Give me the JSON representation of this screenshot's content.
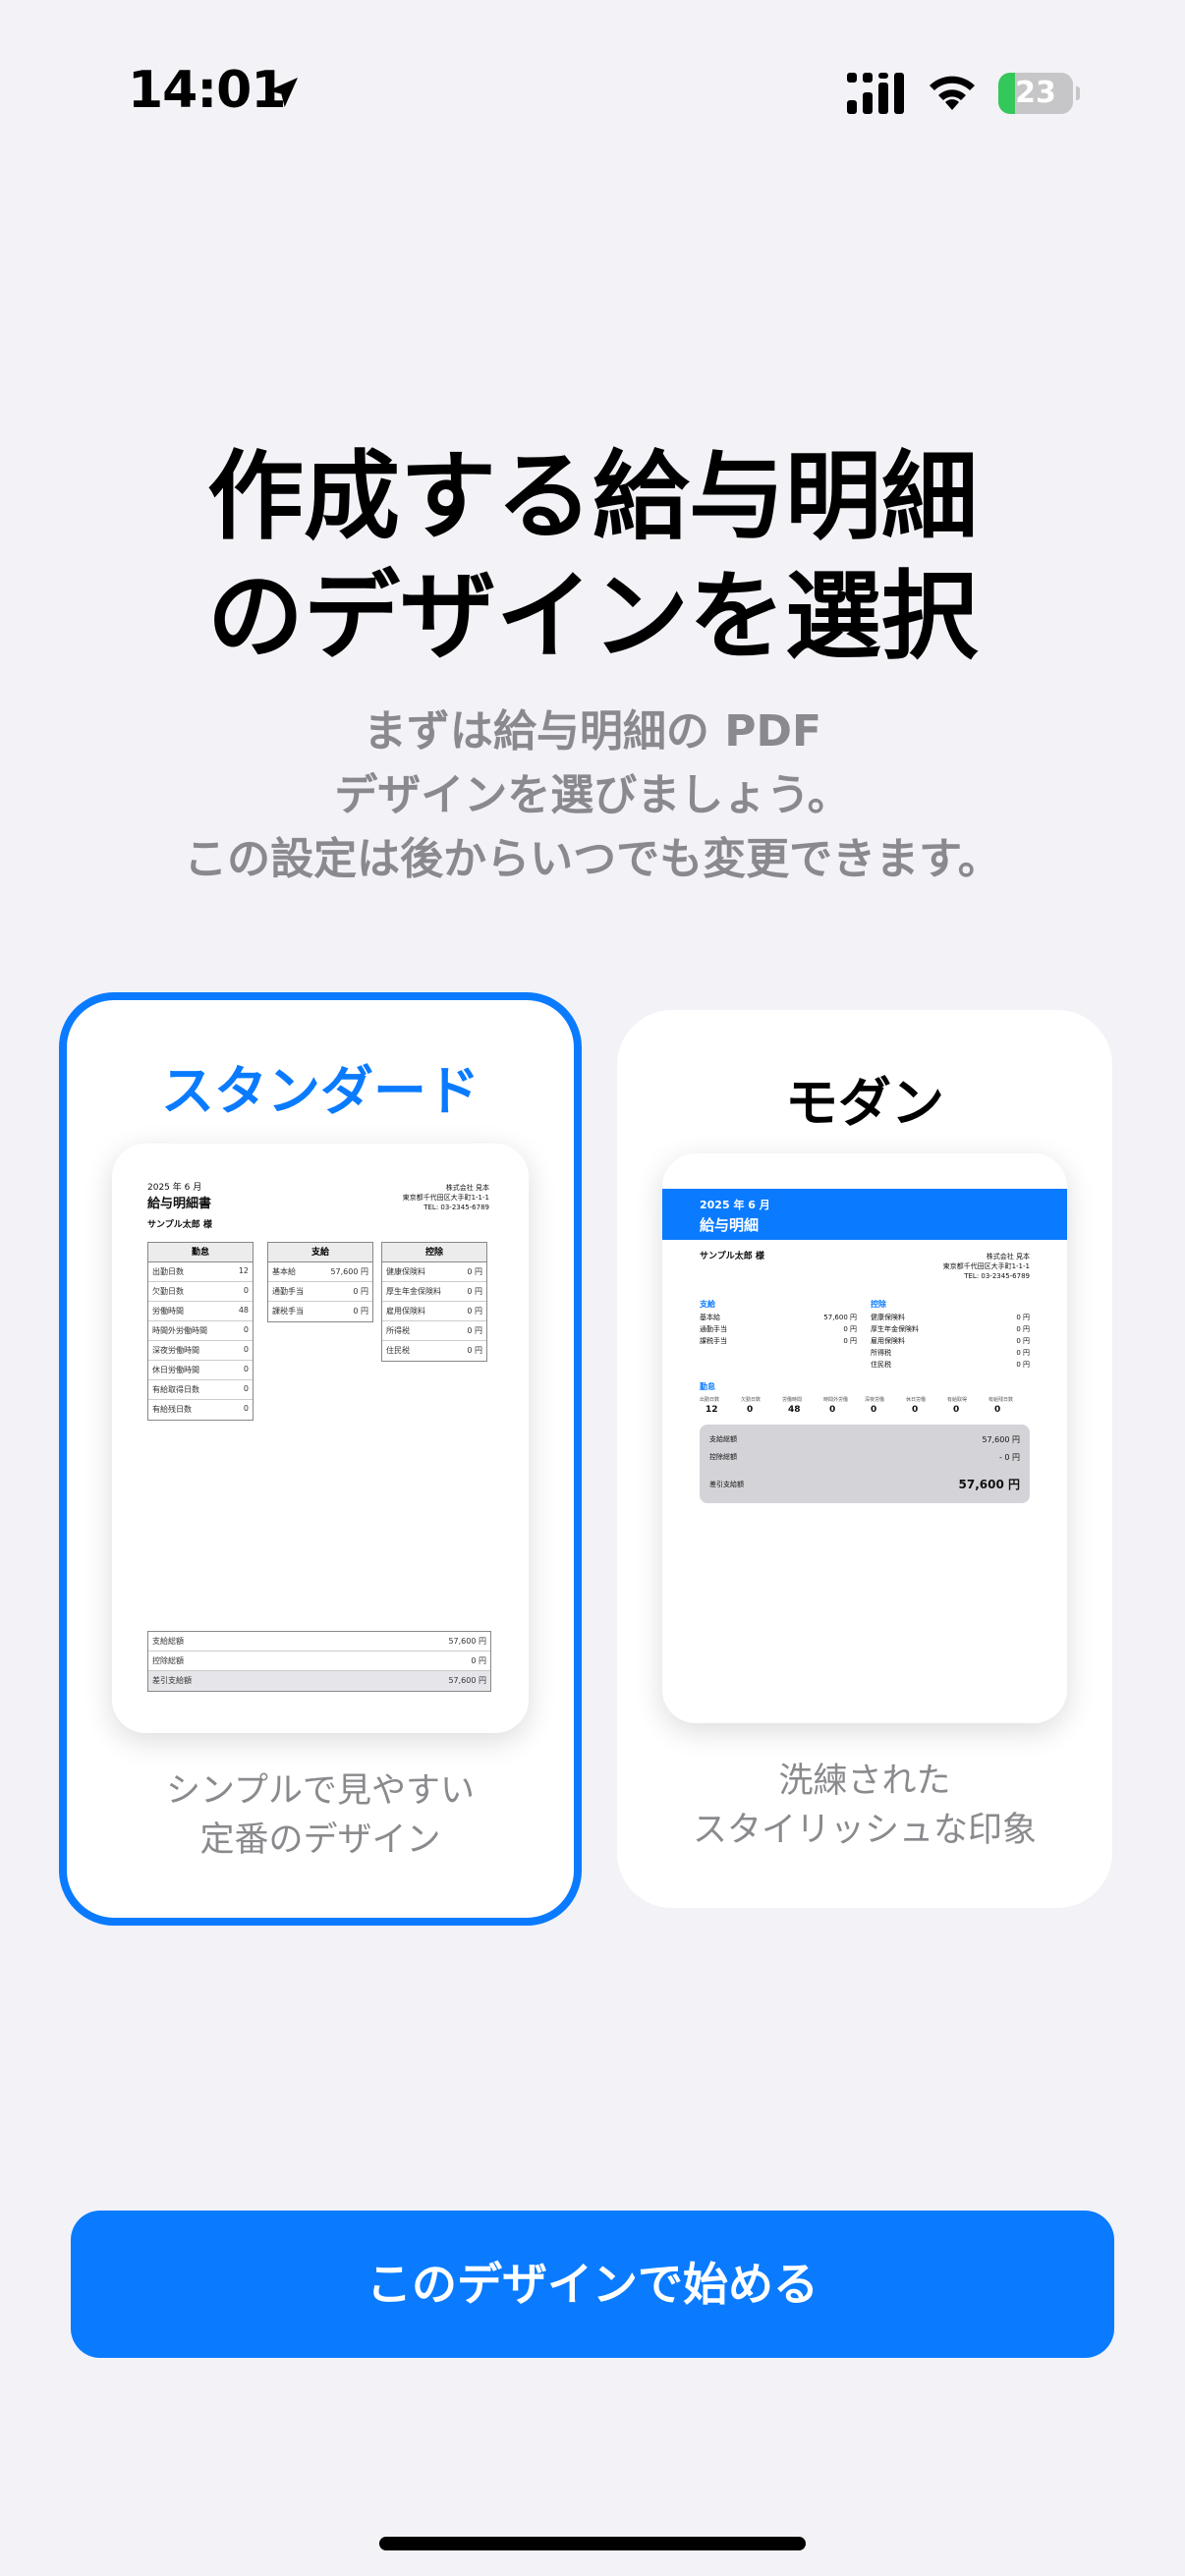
{
  "status_bar": {
    "time": "14:01",
    "battery_level": "23",
    "battery_fraction": 0.23,
    "battery_color": "#34c759"
  },
  "heading": {
    "title_line1": "作成する給与明細",
    "title_line2": "のデザインを選択",
    "subtitle_line1": "まずは給与明細の PDF",
    "subtitle_line2": "デザインを選びましょう。",
    "subtitle_line3": "この設定は後からいつでも変更できます。"
  },
  "options": [
    {
      "title": "スタンダード",
      "selected": true,
      "description_line1": "シンプルで見やすい",
      "description_line2": "定番のデザイン"
    },
    {
      "title": "モダン",
      "selected": false,
      "description_line1": "洗練された",
      "description_line2": "スタイリッシュな印象"
    }
  ],
  "preview_standard": {
    "period": "2025 年 6 月",
    "doc_title": "給与明細書",
    "employee": "サンプル太郎 様",
    "company": "株式会社 見本",
    "address": "東京都千代田区大手町1-1-1",
    "tel": "TEL: 03-2345-6789",
    "col_attendance": "勤怠",
    "col_payment": "支給",
    "col_deduction": "控除",
    "attendance_rows": [
      [
        "出勤日数",
        "12"
      ],
      [
        "欠勤日数",
        "0"
      ],
      [
        "労働時間",
        "48"
      ],
      [
        "時間外労働時間",
        "0"
      ],
      [
        "深夜労働時間",
        "0"
      ],
      [
        "休日労働時間",
        "0"
      ],
      [
        "有給取得日数",
        "0"
      ],
      [
        "有給残日数",
        "0"
      ]
    ],
    "payment_rows": [
      [
        "基本給",
        "57,600 円"
      ],
      [
        "通勤手当",
        "0 円"
      ],
      [
        "課税手当",
        "0 円"
      ]
    ],
    "deduction_rows": [
      [
        "健康保険料",
        "0 円"
      ],
      [
        "厚生年金保険料",
        "0 円"
      ],
      [
        "雇用保険料",
        "0 円"
      ],
      [
        "所得税",
        "0 円"
      ],
      [
        "住民税",
        "0 円"
      ]
    ],
    "total_rows": [
      [
        "支給総額",
        "57,600 円"
      ],
      [
        "控除総額",
        "0 円"
      ],
      [
        "差引支給額",
        "57,600 円"
      ]
    ]
  },
  "preview_modern": {
    "period": "2025 年 6 月",
    "doc_title": "給与明細",
    "employee": "サンプル太郎 様",
    "company": "株式会社 見本",
    "address": "東京都千代田区大手町1-1-1",
    "tel": "TEL: 03-2345-6789",
    "label_payment": "支給",
    "label_deduction": "控除",
    "label_attendance": "勤怠",
    "payment_rows": [
      [
        "基本給",
        "57,600 円"
      ],
      [
        "通勤手当",
        "0 円"
      ],
      [
        "課税手当",
        "0 円"
      ]
    ],
    "deduction_rows": [
      [
        "健康保険料",
        "0 円"
      ],
      [
        "厚生年金保険料",
        "0 円"
      ],
      [
        "雇用保険料",
        "0 円"
      ],
      [
        "所得税",
        "0 円"
      ],
      [
        "住民税",
        "0 円"
      ]
    ],
    "attendance_cells": [
      [
        "出勤日数",
        "12"
      ],
      [
        "欠勤日数",
        "0"
      ],
      [
        "労働時間",
        "48"
      ],
      [
        "時間外労働",
        "0"
      ],
      [
        "深夜労働",
        "0"
      ],
      [
        "休日労働",
        "0"
      ],
      [
        "有給取得",
        "0"
      ],
      [
        "有給残日数",
        "0"
      ]
    ],
    "total_pay_label": "支給総額",
    "total_pay": "57,600 円",
    "total_deduct_label": "控除総額",
    "total_deduct": "- 0 円",
    "net_label": "差引支給額",
    "net": "57,600 円"
  },
  "start_button": "このデザインで始める",
  "colors": {
    "accent": "#0a7bff",
    "background": "#f2f2f7",
    "secondary_text": "#8a8a8e"
  }
}
